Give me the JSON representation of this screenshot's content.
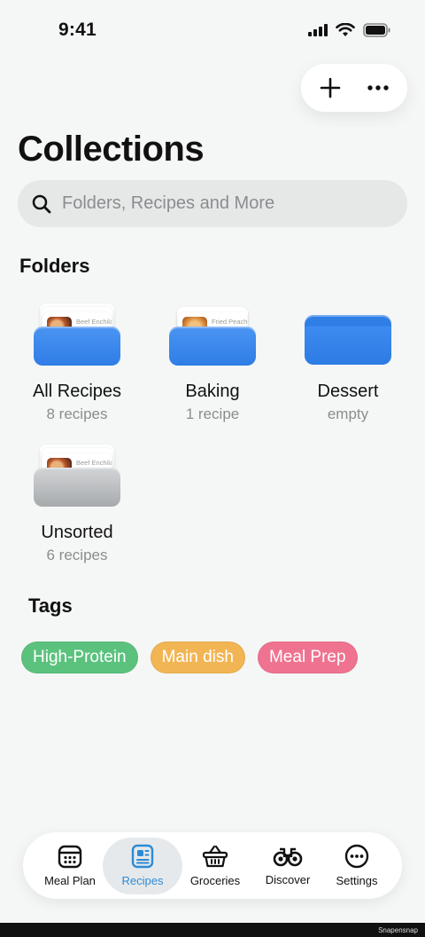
{
  "status_bar": {
    "time": "9:41"
  },
  "header": {
    "title": "Collections"
  },
  "search": {
    "placeholder": "Folders, Recipes and More",
    "value": ""
  },
  "folders_section": {
    "title": "Folders"
  },
  "folders": [
    {
      "name": "All Recipes",
      "count": "8 recipes",
      "preview": "Beef Enchiladas",
      "style": "blue"
    },
    {
      "name": "Baking",
      "count": "1 recipe",
      "preview": "Fried Peach Cobbler",
      "style": "blue"
    },
    {
      "name": "Dessert",
      "count": "empty",
      "style": "blue-empty"
    },
    {
      "name": "Unsorted",
      "count": "6 recipes",
      "preview": "Beef Enchiladas",
      "style": "grey"
    }
  ],
  "tags_section": {
    "title": "Tags"
  },
  "tags": [
    {
      "label": "High-Protein",
      "color": "#5bc27e"
    },
    {
      "label": "Main dish",
      "color": "#f2b554"
    },
    {
      "label": "Meal Prep",
      "color": "#ef7390"
    }
  ],
  "tabbar": {
    "active": "Recipes",
    "accent": "#2d8bd6",
    "items": [
      {
        "label": "Meal Plan",
        "icon": "calendar-icon"
      },
      {
        "label": "Recipes",
        "icon": "recipe-card-icon"
      },
      {
        "label": "Groceries",
        "icon": "basket-icon"
      },
      {
        "label": "Discover",
        "icon": "binoculars-icon"
      },
      {
        "label": "Settings",
        "icon": "ellipsis-circle-icon"
      }
    ]
  },
  "watermark": "Snapensnap"
}
